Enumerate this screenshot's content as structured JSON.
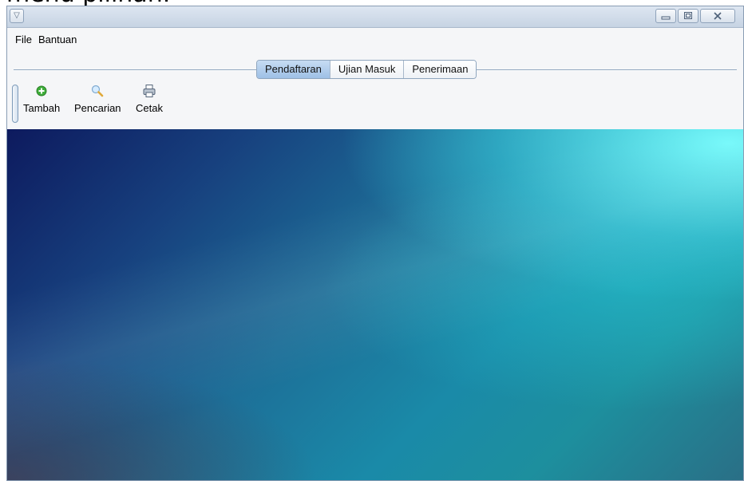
{
  "top_clipped_text": "menu pilihan.",
  "titlebar": {
    "system_menu_glyph": "▽",
    "minimize_icon": "minimize-icon",
    "maximize_icon": "maximize-icon",
    "close_icon": "close-icon"
  },
  "menubar": {
    "items": [
      {
        "label": "File"
      },
      {
        "label": "Bantuan"
      }
    ]
  },
  "tabs": [
    {
      "label": "Pendaftaran",
      "active": true
    },
    {
      "label": "Ujian Masuk",
      "active": false
    },
    {
      "label": "Penerimaan",
      "active": false
    }
  ],
  "toolbar": {
    "tambah_label": "Tambah",
    "pencarian_label": "Pencarian",
    "cetak_label": "Cetak"
  },
  "colors": {
    "accent": "#9ec0e6",
    "tambah_icon": "#3fae3a",
    "pencarian_icon": "#e0a93a",
    "desktop_top_left": "#0d1a5e",
    "desktop_top_right": "#78ffff"
  }
}
